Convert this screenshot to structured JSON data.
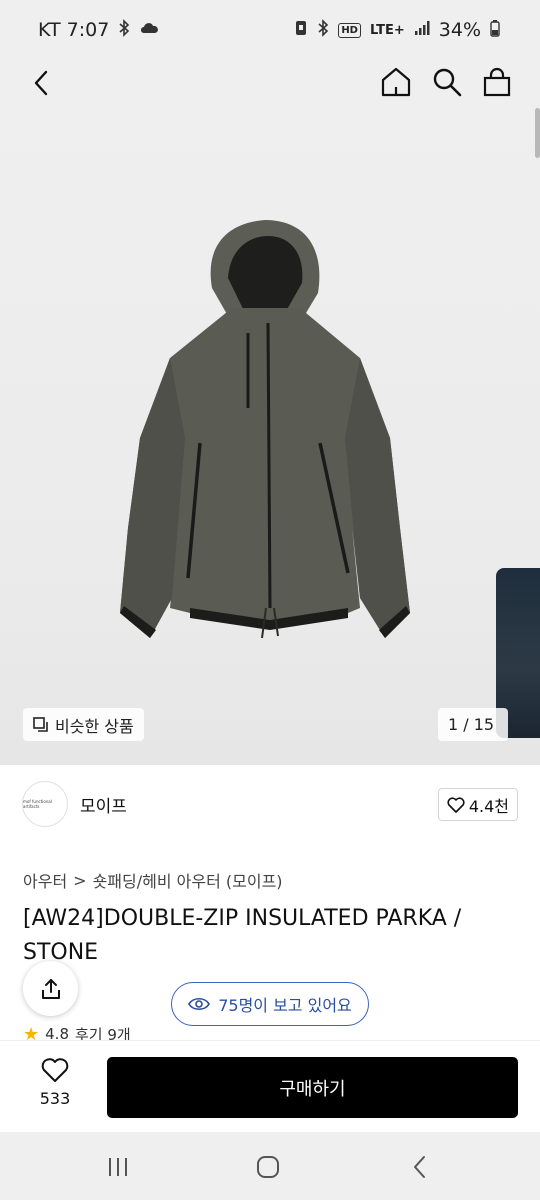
{
  "status_bar": {
    "carrier_time": "KT 7:07",
    "network": "LTE+",
    "battery": "34%"
  },
  "header": {
    "back_icon": "chevron-left-icon",
    "home_icon": "home-icon",
    "search_icon": "search-icon",
    "cart_icon": "shopping-bag-icon"
  },
  "image": {
    "similar_label": "비슷한 상품",
    "counter": "1 / 15"
  },
  "brand": {
    "name": "모이프",
    "logo_text": "mof functional artifacts",
    "likes": "4.4천"
  },
  "breadcrumb": {
    "category": "아우터",
    "separator": ">",
    "subcategory": "숏패딩/헤비 아우터 (모이프)"
  },
  "product": {
    "title": "[AW24]DOUBLE-ZIP INSULATED PARKA / STONE",
    "rating": "4.8",
    "reviews": "후기 9개"
  },
  "viewers": {
    "label": "75명이 보고 있어요"
  },
  "bottom": {
    "wish_count": "533",
    "buy_label": "구매하기"
  },
  "colors": {
    "accent": "#3d62b8",
    "buy_bg": "#000000",
    "jacket": "#5c5d55"
  }
}
